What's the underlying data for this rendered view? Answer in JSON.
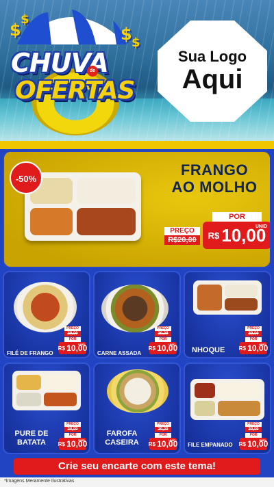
{
  "header": {
    "title_line1": "CHUVA",
    "title_de": "de",
    "title_line2": "OFERTAS",
    "logo_line1": "Sua Logo",
    "logo_line2": "Aqui",
    "dollar": "$"
  },
  "featured": {
    "badge": "-50%",
    "name_line1": "FRANGO",
    "name_line2": "AO MOLHO",
    "preco_label": "PREÇO",
    "old_price": "R$20,00",
    "por_label": "POR",
    "currency": "R$",
    "new_price": "10,00",
    "unit": "UNID"
  },
  "products": [
    {
      "name": "FILÉ DE FRANGO",
      "preco_label": "PREÇO",
      "old_price": "20,00",
      "por_label": "POR",
      "currency": "R$",
      "new_price": "10,00",
      "unit": "UNID"
    },
    {
      "name": "CARNE ASSADA",
      "preco_label": "PREÇO",
      "old_price": "20,00",
      "por_label": "POR",
      "currency": "R$",
      "new_price": "10,00",
      "unit": "UNID"
    },
    {
      "name": "NHOQUE",
      "preco_label": "PREÇO",
      "old_price": "20,00",
      "por_label": "POR",
      "currency": "R$",
      "new_price": "10,00",
      "unit": "UNID"
    },
    {
      "name_line1": "PURE DE",
      "name_line2": "BATATA",
      "preco_label": "PREÇO",
      "old_price": "20,00",
      "por_label": "POR",
      "currency": "R$",
      "new_price": "10,00",
      "unit": "UNID"
    },
    {
      "name_line1": "FAROFA",
      "name_line2": "CASEIRA",
      "preco_label": "PREÇO",
      "old_price": "20,00",
      "por_label": "POR",
      "currency": "R$",
      "new_price": "10,00",
      "unit": "UNID"
    },
    {
      "name": "FILE EMPANADO",
      "preco_label": "PREÇO",
      "old_price": "20,00",
      "por_label": "POR",
      "currency": "R$",
      "new_price": "10,00",
      "unit": "UNID"
    }
  ],
  "cta": {
    "label": "Crie seu encarte com este tema!"
  },
  "footer": {
    "note": "*Imagens Meramente Ilustrativas"
  }
}
